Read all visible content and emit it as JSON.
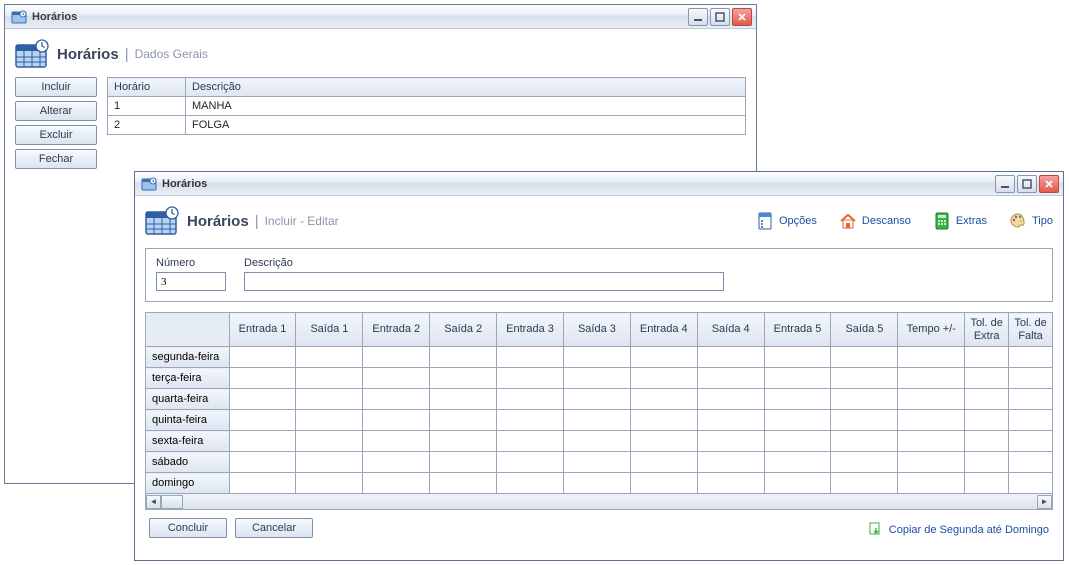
{
  "colors": {
    "accent": "#1b4fa3",
    "border": "#7e8ea8",
    "header_bg_top": "#f3f6fb",
    "header_bg_bot": "#dde5f1"
  },
  "win1": {
    "title": "Horários",
    "header_title": "Horários",
    "header_sub": "Dados Gerais",
    "buttons": {
      "incluir": "Incluir",
      "alterar": "Alterar",
      "excluir": "Excluir",
      "fechar": "Fechar"
    },
    "grid": {
      "columns": [
        "Horário",
        "Descrição"
      ],
      "rows": [
        {
          "horario": "1",
          "descricao": "MANHA"
        },
        {
          "horario": "2",
          "descricao": "FOLGA"
        }
      ]
    }
  },
  "win2": {
    "title": "Horários",
    "header_title": "Horários",
    "header_sub": "Incluir - Editar",
    "toolbar": {
      "opcoes": "Opções",
      "descanso": "Descanso",
      "extras": "Extras",
      "tipo": "Tipo"
    },
    "form": {
      "numero_label": "Número",
      "numero_value": "3",
      "descricao_label": "Descrição",
      "descricao_value": ""
    },
    "schedule": {
      "columns": [
        "Entrada 1",
        "Saída 1",
        "Entrada 2",
        "Saída 2",
        "Entrada 3",
        "Saída 3",
        "Entrada 4",
        "Saída 4",
        "Entrada 5",
        "Saída 5",
        "Tempo +/-",
        "Tol. de Extra",
        "Tol. de Falta"
      ],
      "days": [
        "segunda-feira",
        "terça-feira",
        "quarta-feira",
        "quinta-feira",
        "sexta-feira",
        "sábado",
        "domingo"
      ]
    },
    "bottom": {
      "concluir": "Concluir",
      "cancelar": "Cancelar",
      "copy_link": "Copiar de Segunda até Domingo"
    }
  }
}
